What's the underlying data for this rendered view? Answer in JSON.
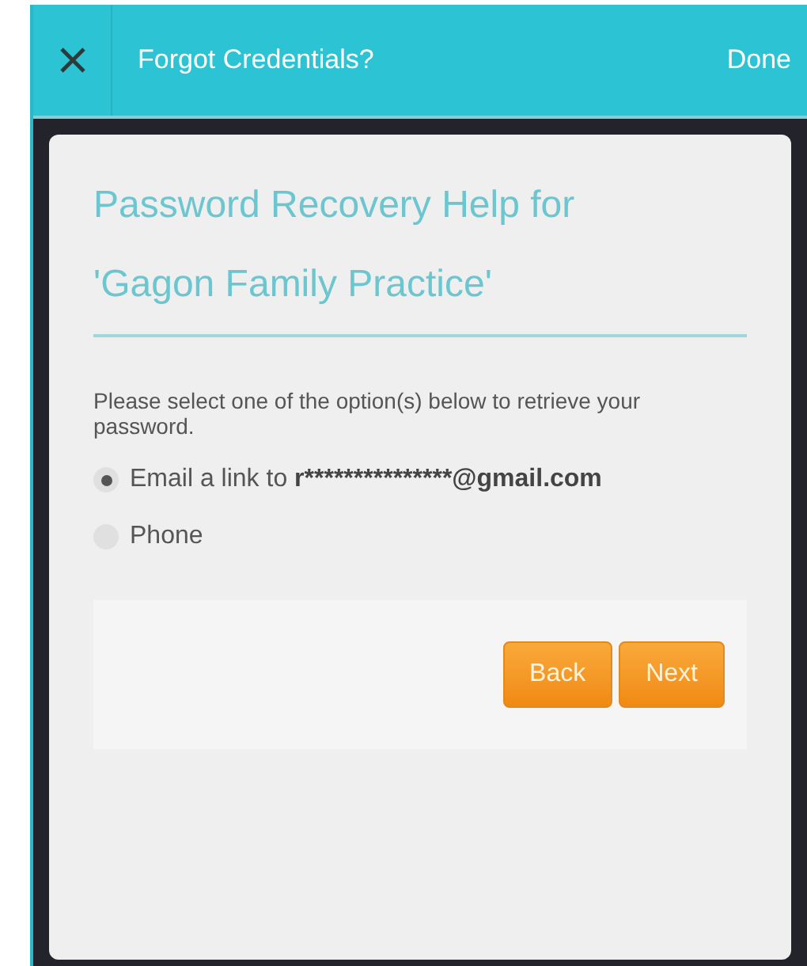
{
  "header": {
    "title": "Forgot Credentials?",
    "action": "Done"
  },
  "card": {
    "heading_lines": [
      "Password Recovery Help for",
      "'Gagon Family Practice'"
    ],
    "instruction": "Please select one of the option(s) below to retrieve your password.",
    "options": [
      {
        "label": "Email a link to",
        "detail": "r***************@gmail.com",
        "selected": true
      },
      {
        "label": "Phone",
        "selected": false
      }
    ],
    "buttons": [
      "Back",
      "Next"
    ]
  }
}
